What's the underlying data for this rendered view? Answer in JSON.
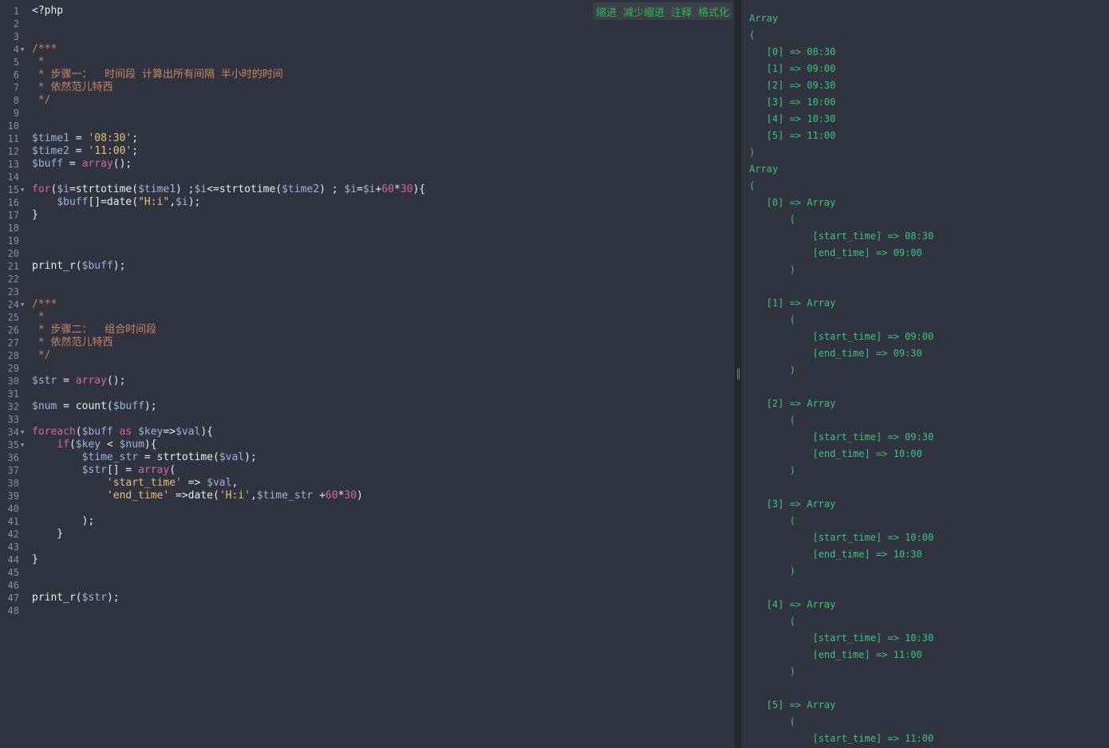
{
  "toolbar": {
    "indent": "缩进",
    "outdent": "减少缩进",
    "comment": "注释",
    "format": "格式化"
  },
  "editor": {
    "line_count": 48,
    "folds": [
      4,
      15,
      24,
      34,
      35
    ],
    "lines": [
      [
        [
          "fn",
          "<?php"
        ]
      ],
      [],
      [],
      [
        [
          "c",
          "/***"
        ]
      ],
      [
        [
          "c",
          " *"
        ]
      ],
      [
        [
          "c",
          " * 步骤一：  时间段 计算出所有间隔 半小时的时间"
        ]
      ],
      [
        [
          "c",
          " * 依然范儿特西"
        ]
      ],
      [
        [
          "c",
          " */"
        ]
      ],
      [],
      [],
      [
        [
          "v",
          "$time1"
        ],
        [
          "fn",
          " = "
        ],
        [
          "s",
          "'08:30'"
        ],
        [
          "fn",
          ";"
        ]
      ],
      [
        [
          "v",
          "$time2"
        ],
        [
          "fn",
          " = "
        ],
        [
          "s",
          "'11:00'"
        ],
        [
          "fn",
          ";"
        ]
      ],
      [
        [
          "v",
          "$buff"
        ],
        [
          "fn",
          " = "
        ],
        [
          "k",
          "array"
        ],
        [
          "fn",
          "();"
        ]
      ],
      [],
      [
        [
          "k",
          "for"
        ],
        [
          "fn",
          "("
        ],
        [
          "v",
          "$i"
        ],
        [
          "fn",
          "=strtotime("
        ],
        [
          "v",
          "$time1"
        ],
        [
          "fn",
          ") ;"
        ],
        [
          "v",
          "$i"
        ],
        [
          "fn",
          "<=strtotime("
        ],
        [
          "v",
          "$time2"
        ],
        [
          "fn",
          ") ; "
        ],
        [
          "v",
          "$i"
        ],
        [
          "fn",
          "="
        ],
        [
          "v",
          "$i"
        ],
        [
          "fn",
          "+"
        ],
        [
          "num",
          "60"
        ],
        [
          "fn",
          "*"
        ],
        [
          "num",
          "30"
        ],
        [
          "fn",
          "){"
        ]
      ],
      [
        [
          "fn",
          "    "
        ],
        [
          "v",
          "$buff"
        ],
        [
          "fn",
          "[]=date("
        ],
        [
          "s",
          "\"H:i\""
        ],
        [
          "fn",
          ","
        ],
        [
          "v",
          "$i"
        ],
        [
          "fn",
          ");"
        ]
      ],
      [
        [
          "fn",
          "}"
        ]
      ],
      [],
      [],
      [],
      [
        [
          "fn",
          "print_r("
        ],
        [
          "v",
          "$buff"
        ],
        [
          "fn",
          ");"
        ]
      ],
      [],
      [],
      [
        [
          "c",
          "/***"
        ]
      ],
      [
        [
          "c",
          " *"
        ]
      ],
      [
        [
          "c",
          " * 步骤二：  组合时间段"
        ]
      ],
      [
        [
          "c",
          " * 依然范儿特西"
        ]
      ],
      [
        [
          "c",
          " */"
        ]
      ],
      [],
      [
        [
          "v",
          "$str"
        ],
        [
          "fn",
          " = "
        ],
        [
          "k",
          "array"
        ],
        [
          "fn",
          "();"
        ]
      ],
      [],
      [
        [
          "v",
          "$num"
        ],
        [
          "fn",
          " = count("
        ],
        [
          "v",
          "$buff"
        ],
        [
          "fn",
          ");"
        ]
      ],
      [],
      [
        [
          "k",
          "foreach"
        ],
        [
          "fn",
          "("
        ],
        [
          "v",
          "$buff"
        ],
        [
          "fn",
          " "
        ],
        [
          "k",
          "as"
        ],
        [
          "fn",
          " "
        ],
        [
          "v",
          "$key"
        ],
        [
          "fn",
          "=>"
        ],
        [
          "v",
          "$val"
        ],
        [
          "fn",
          "){"
        ]
      ],
      [
        [
          "fn",
          "    "
        ],
        [
          "k",
          "if"
        ],
        [
          "fn",
          "("
        ],
        [
          "v",
          "$key"
        ],
        [
          "fn",
          " < "
        ],
        [
          "v",
          "$num"
        ],
        [
          "fn",
          "){"
        ]
      ],
      [
        [
          "fn",
          "        "
        ],
        [
          "v",
          "$time_str"
        ],
        [
          "fn",
          " = strtotime("
        ],
        [
          "v",
          "$val"
        ],
        [
          "fn",
          ");"
        ]
      ],
      [
        [
          "fn",
          "        "
        ],
        [
          "v",
          "$str"
        ],
        [
          "fn",
          "[] = "
        ],
        [
          "k",
          "array"
        ],
        [
          "fn",
          "("
        ]
      ],
      [
        [
          "fn",
          "            "
        ],
        [
          "s",
          "'start_time'"
        ],
        [
          "fn",
          " => "
        ],
        [
          "v",
          "$val"
        ],
        [
          "fn",
          ","
        ]
      ],
      [
        [
          "fn",
          "            "
        ],
        [
          "s",
          "'end_time'"
        ],
        [
          "fn",
          " =>date("
        ],
        [
          "s",
          "'H:i'"
        ],
        [
          "fn",
          ","
        ],
        [
          "v",
          "$time_str"
        ],
        [
          "fn",
          " +"
        ],
        [
          "num",
          "60"
        ],
        [
          "fn",
          "*"
        ],
        [
          "num",
          "30"
        ],
        [
          "fn",
          ")"
        ]
      ],
      [],
      [
        [
          "fn",
          "        );"
        ]
      ],
      [
        [
          "fn",
          "    }"
        ]
      ],
      [],
      [
        [
          "fn",
          "}"
        ]
      ],
      [],
      [],
      [
        [
          "fn",
          "print_r("
        ],
        [
          "v",
          "$str"
        ],
        [
          "fn",
          ");"
        ]
      ],
      []
    ]
  },
  "output": {
    "lines": [
      "Array",
      "(",
      "   [0] => 08:30",
      "   [1] => 09:00",
      "   [2] => 09:30",
      "   [3] => 10:00",
      "   [4] => 10:30",
      "   [5] => 11:00",
      ")",
      "Array",
      "(",
      "   [0] => Array",
      "       (",
      "           [start_time] => 08:30",
      "           [end_time] => 09:00",
      "       )",
      "",
      "   [1] => Array",
      "       (",
      "           [start_time] => 09:00",
      "           [end_time] => 09:30",
      "       )",
      "",
      "   [2] => Array",
      "       (",
      "           [start_time] => 09:30",
      "           [end_time] => 10:00",
      "       )",
      "",
      "   [3] => Array",
      "       (",
      "           [start_time] => 10:00",
      "           [end_time] => 10:30",
      "       )",
      "",
      "   [4] => Array",
      "       (",
      "           [start_time] => 10:30",
      "           [end_time] => 11:00",
      "       )",
      "",
      "   [5] => Array",
      "       (",
      "           [start_time] => 11:00"
    ]
  }
}
